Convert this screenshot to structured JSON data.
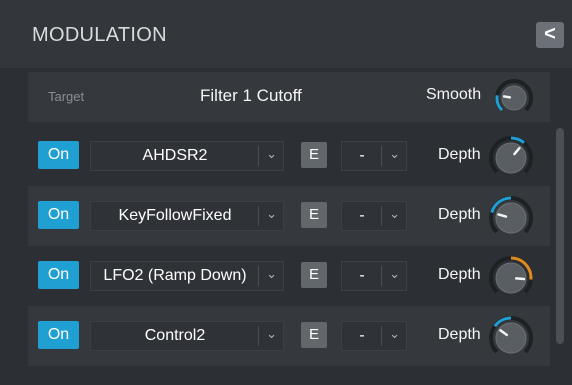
{
  "panel": {
    "title": "MODULATION",
    "collapse_label": "<"
  },
  "target": {
    "label": "Target",
    "value": "Filter 1 Cutoff",
    "smooth_label": "Smooth",
    "smooth_level": 0.2
  },
  "rows": [
    {
      "on_label": "On",
      "source": "AHDSR2",
      "e_label": "E",
      "via": "-",
      "depth_label": "Depth",
      "depth": 0.3
    },
    {
      "on_label": "On",
      "source": "KeyFollowFixed",
      "e_label": "E",
      "via": "-",
      "depth_label": "Depth",
      "depth": -0.55
    },
    {
      "on_label": "On",
      "source": "LFO2 (Ramp Down)",
      "e_label": "E",
      "via": "-",
      "depth_label": "Depth",
      "depth": 0.7
    },
    {
      "on_label": "On",
      "source": "Control2",
      "e_label": "E",
      "via": "-",
      "depth_label": "Depth",
      "depth": -0.4
    }
  ],
  "colors": {
    "accent_blue": "#1f9fd2",
    "accent_orange": "#e08a1e"
  }
}
